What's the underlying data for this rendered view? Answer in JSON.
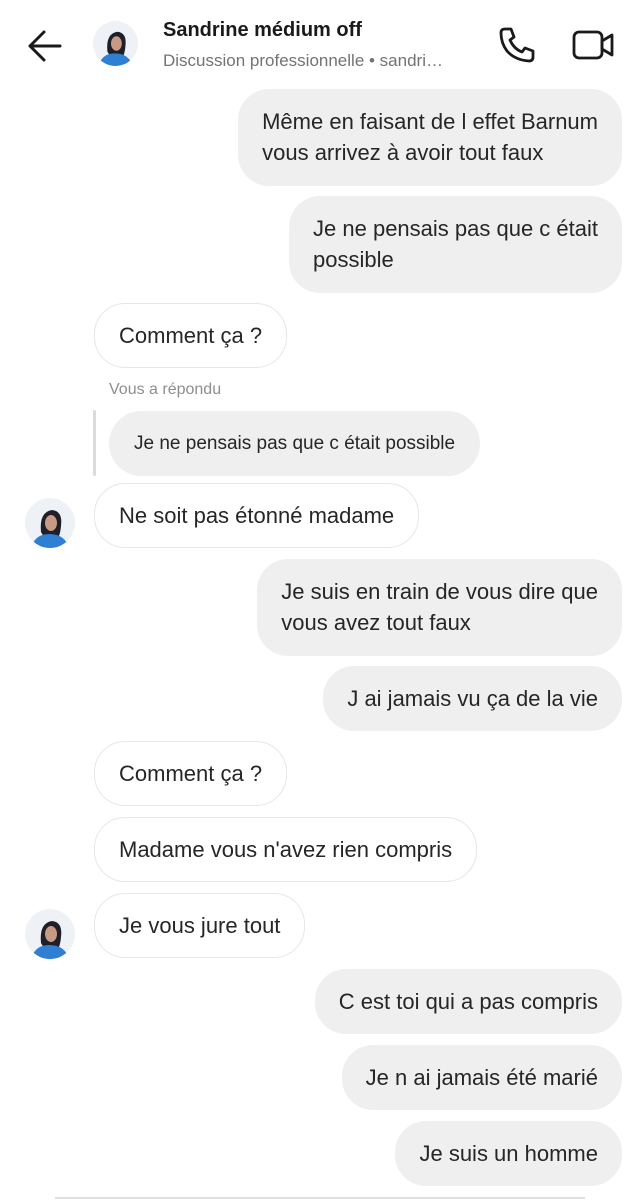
{
  "header": {
    "contact_name": "Sandrine médium off",
    "subtitle": "Discussion professionnelle • sandri…",
    "back_icon": "arrow-left-icon",
    "call_icon": "phone-icon",
    "video_icon": "video-camera-icon"
  },
  "messages": [
    {
      "side": "sent",
      "lines": [
        "Même en faisant de l effet Barnum",
        "vous arrivez à avoir tout faux"
      ]
    },
    {
      "side": "sent",
      "lines": [
        "Je ne pensais pas que c était",
        "possible"
      ]
    },
    {
      "side": "received",
      "lines": [
        "Comment ça ?"
      ]
    },
    {
      "side": "received",
      "reply_label": "Vous a répondu",
      "reply_quote": "Je ne pensais pas que c était possible",
      "lines": [
        "Ne soit pas étonné madame"
      ],
      "avatar": true
    },
    {
      "side": "sent",
      "lines": [
        "Je suis en train de vous dire que",
        "vous avez tout faux"
      ]
    },
    {
      "side": "sent",
      "lines": [
        "J ai jamais vu ça de la vie"
      ]
    },
    {
      "side": "received",
      "lines": [
        "Comment ça ?"
      ]
    },
    {
      "side": "received",
      "lines": [
        "Madame vous n'avez rien compris"
      ]
    },
    {
      "side": "received",
      "lines": [
        "Je vous jure tout"
      ],
      "avatar": true
    },
    {
      "side": "sent",
      "lines": [
        "C est toi qui a pas compris"
      ]
    },
    {
      "side": "sent",
      "lines": [
        "Je n ai jamais été marié"
      ]
    },
    {
      "side": "sent",
      "lines": [
        "Je suis un homme"
      ]
    }
  ],
  "colors": {
    "sent_bubble": "#efefef",
    "received_bubble_border": "#e6e6e6",
    "text": "#262626",
    "secondary_text": "#737373",
    "avatar_accent": "#2f7fd3"
  }
}
